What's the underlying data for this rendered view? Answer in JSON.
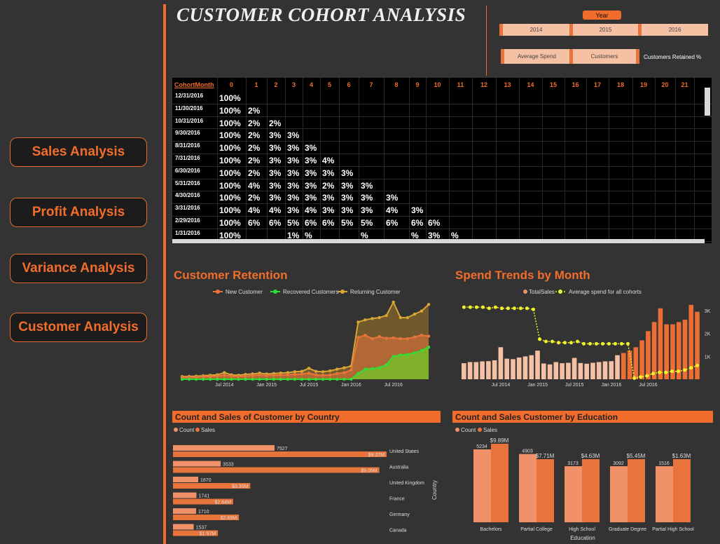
{
  "nav": {
    "buttons": [
      "Sales Analysis",
      "Profit Analysis",
      "Variance Analysis",
      "Customer Analysis"
    ]
  },
  "header": {
    "title": "CUSTOMER COHORT  ANALYSIS",
    "year_label": "Year",
    "years": [
      "2014",
      "2015",
      "2016"
    ],
    "measures": [
      "Average Spend",
      "Customers"
    ],
    "selected_measure": "Customers Retained %"
  },
  "cohort_table": {
    "corner": "CohortMonth",
    "columns": [
      "0",
      "1",
      "2",
      "3",
      "4",
      "5",
      "6",
      "7",
      "8",
      "9",
      "10",
      "11",
      "12",
      "13",
      "14",
      "15",
      "16",
      "17",
      "18",
      "19",
      "20",
      "21"
    ],
    "rows": [
      {
        "month": "12/31/2016",
        "cells": [
          "100%"
        ]
      },
      {
        "month": "11/30/2016",
        "cells": [
          "100%",
          "2%"
        ]
      },
      {
        "month": "10/31/2016",
        "cells": [
          "100%",
          "2%",
          "2%"
        ]
      },
      {
        "month": "9/30/2016",
        "cells": [
          "100%",
          "2%",
          "3%",
          "3%"
        ]
      },
      {
        "month": "8/31/2016",
        "cells": [
          "100%",
          "2%",
          "3%",
          "3%",
          "3%"
        ]
      },
      {
        "month": "7/31/2016",
        "cells": [
          "100%",
          "2%",
          "3%",
          "3%",
          "3%",
          "4%"
        ]
      },
      {
        "month": "6/30/2016",
        "cells": [
          "100%",
          "2%",
          "3%",
          "3%",
          "3%",
          "3%",
          "3%"
        ]
      },
      {
        "month": "5/31/2016",
        "cells": [
          "100%",
          "4%",
          "3%",
          "3%",
          "3%",
          "2%",
          "3%",
          "3%"
        ]
      },
      {
        "month": "4/30/2016",
        "cells": [
          "100%",
          "2%",
          "3%",
          "3%",
          "3%",
          "3%",
          "3%",
          "3%",
          "3%"
        ]
      },
      {
        "month": "3/31/2016",
        "cells": [
          "100%",
          "4%",
          "4%",
          "3%",
          "4%",
          "3%",
          "3%",
          "3%",
          "4%",
          "3%"
        ]
      },
      {
        "month": "2/29/2016",
        "cells": [
          "100%",
          "6%",
          "6%",
          "5%",
          "6%",
          "6%",
          "5%",
          "5%",
          "6%",
          "6%",
          "6%"
        ]
      },
      {
        "month": "1/31/2016",
        "cells": [
          "100%",
          "",
          "",
          "1%",
          "%",
          "",
          "",
          "%",
          "",
          "%",
          "3%",
          "%"
        ]
      }
    ]
  },
  "retention": {
    "title": "Customer Retention",
    "legend": [
      "New Customer",
      "Recovered Customers",
      "Returning Customer"
    ],
    "x_ticks": [
      "Jul 2014",
      "Jan 2015",
      "Jul 2015",
      "Jan 2016",
      "Jul 2016"
    ],
    "colors": {
      "new": "#e8743b",
      "recovered": "#33dd33",
      "returning": "#d9a535"
    }
  },
  "spend": {
    "title": "Spend Trends by Month",
    "legend": [
      "TotalSales",
      "Average spend for all cohorts"
    ],
    "x_ticks": [
      "Jul 2014",
      "Jan 2015",
      "Jul 2015",
      "Jan 2016",
      "Jul 2016"
    ],
    "y_ticks": [
      "3K",
      "2K",
      "1K"
    ]
  },
  "country_chart": {
    "title": "Count and Sales of Customer by Country",
    "legend": [
      "Count",
      "Sales"
    ],
    "axis_label": "Country"
  },
  "education_chart": {
    "title": "Count and Sales Customer by Education",
    "legend": [
      "Count",
      "Sales"
    ],
    "axis_label": "Education"
  },
  "chart_data": [
    {
      "type": "line",
      "title": "Customer Retention",
      "x": [
        "Jan 2014",
        "Feb 2014",
        "Mar 2014",
        "Apr 2014",
        "May 2014",
        "Jun 2014",
        "Jul 2014",
        "Aug 2014",
        "Sep 2014",
        "Oct 2014",
        "Nov 2014",
        "Dec 2014",
        "Jan 2015",
        "Feb 2015",
        "Mar 2015",
        "Apr 2015",
        "May 2015",
        "Jun 2015",
        "Jul 2015",
        "Aug 2015",
        "Sep 2015",
        "Oct 2015",
        "Nov 2015",
        "Dec 2015",
        "Jan 2016",
        "Feb 2016",
        "Mar 2016",
        "Apr 2016",
        "May 2016",
        "Jun 2016",
        "Jul 2016",
        "Aug 2016",
        "Sep 2016",
        "Oct 2016",
        "Nov 2016",
        "Dec 2016"
      ],
      "ylim": [
        0,
        1800
      ],
      "series": [
        {
          "name": "New Customer",
          "values": [
            40,
            45,
            50,
            55,
            60,
            70,
            90,
            70,
            60,
            70,
            80,
            95,
            85,
            90,
            95,
            100,
            110,
            120,
            140,
            100,
            90,
            95,
            130,
            150,
            210,
            950,
            1000,
            920,
            970,
            930,
            940,
            920,
            920,
            960,
            1000,
            980
          ]
        },
        {
          "name": "Recovered Customers",
          "values": [
            0,
            0,
            0,
            0,
            0,
            0,
            0,
            0,
            0,
            0,
            0,
            0,
            0,
            0,
            0,
            0,
            0,
            0,
            0,
            0,
            0,
            0,
            0,
            0,
            0,
            130,
            230,
            240,
            260,
            330,
            520,
            550,
            560,
            600,
            650,
            730
          ]
        },
        {
          "name": "Returning Customer",
          "values": [
            60,
            65,
            70,
            80,
            90,
            100,
            150,
            100,
            90,
            110,
            120,
            140,
            120,
            130,
            140,
            150,
            170,
            180,
            250,
            180,
            170,
            190,
            230,
            260,
            300,
            1300,
            1350,
            1380,
            1400,
            1450,
            1750,
            1400,
            1400,
            1480,
            1550,
            1700
          ]
        }
      ]
    },
    {
      "type": "bar",
      "title": "Spend Trends by Month",
      "x": [
        "Jan 2014",
        "Feb 2014",
        "Mar 2014",
        "Apr 2014",
        "May 2014",
        "Jun 2014",
        "Jul 2014",
        "Aug 2014",
        "Sep 2014",
        "Oct 2014",
        "Nov 2014",
        "Dec 2014",
        "Jan 2015",
        "Feb 2015",
        "Mar 2015",
        "Apr 2015",
        "May 2015",
        "Jun 2015",
        "Jul 2015",
        "Aug 2015",
        "Sep 2015",
        "Oct 2015",
        "Nov 2015",
        "Dec 2015",
        "Jan 2016",
        "Feb 2016",
        "Mar 2016",
        "Apr 2016",
        "May 2016",
        "Jun 2016",
        "Jul 2016",
        "Aug 2016",
        "Sep 2016",
        "Oct 2016",
        "Nov 2016",
        "Dec 2016"
      ],
      "ylim": [
        0,
        3400
      ],
      "series": [
        {
          "name": "TotalSales",
          "values": [
            700,
            750,
            750,
            780,
            790,
            830,
            1400,
            900,
            880,
            950,
            1000,
            1050,
            1250,
            690,
            650,
            750,
            700,
            720,
            930,
            710,
            680,
            720,
            750,
            780,
            790,
            1050,
            1150,
            1250,
            1400,
            1700,
            2100,
            2500,
            3100,
            2400,
            2400,
            2500,
            2600,
            3250,
            2950
          ]
        },
        {
          "name": "Average spend for all cohorts",
          "values": [
            3150,
            3150,
            3150,
            3150,
            3100,
            3150,
            3100,
            3100,
            3100,
            3100,
            3100,
            3050,
            1750,
            1650,
            1650,
            1600,
            1600,
            1600,
            1650,
            1550,
            1550,
            1550,
            1550,
            1550,
            1550,
            1550,
            1550,
            50,
            100,
            150,
            250,
            300,
            300,
            350,
            350,
            400,
            500,
            600
          ]
        }
      ]
    },
    {
      "type": "bar",
      "title": "Count and Sales of Customer by Country",
      "categories": [
        "United States",
        "Australia",
        "United Kingdom",
        "France",
        "Germany",
        "Canada"
      ],
      "series": [
        {
          "name": "Count",
          "values": [
            7527,
            3533,
            1870,
            1741,
            1710,
            1537
          ],
          "labels": [
            "7527",
            "3533",
            "1870",
            "1741",
            "1710",
            "1537"
          ]
        },
        {
          "name": "Sales",
          "values": [
            9.37,
            9.05,
            3.39,
            2.64,
            2.89,
            1.97
          ],
          "labels": [
            "$9.37M",
            "$9.05M",
            "$3.39M",
            "$2.64M",
            "$2.89M",
            "$1.97M"
          ]
        }
      ]
    },
    {
      "type": "bar",
      "title": "Count and Sales Customer by Education",
      "categories": [
        "Bachelors",
        "Partial College",
        "High School",
        "Graduate Degree",
        "Partial High School"
      ],
      "series": [
        {
          "name": "Count",
          "values": [
            5234,
            4903,
            3173,
            3092,
            1516
          ],
          "labels": [
            "5234",
            "4903",
            "3173",
            "3092",
            "1516"
          ]
        },
        {
          "name": "Sales",
          "values": [
            9.89,
            7.71,
            4.63,
            5.45,
            1.63
          ],
          "labels": [
            "$9.89M",
            "$7.71M",
            "$4.63M",
            "$5.45M",
            "$1.63M"
          ]
        }
      ]
    }
  ]
}
